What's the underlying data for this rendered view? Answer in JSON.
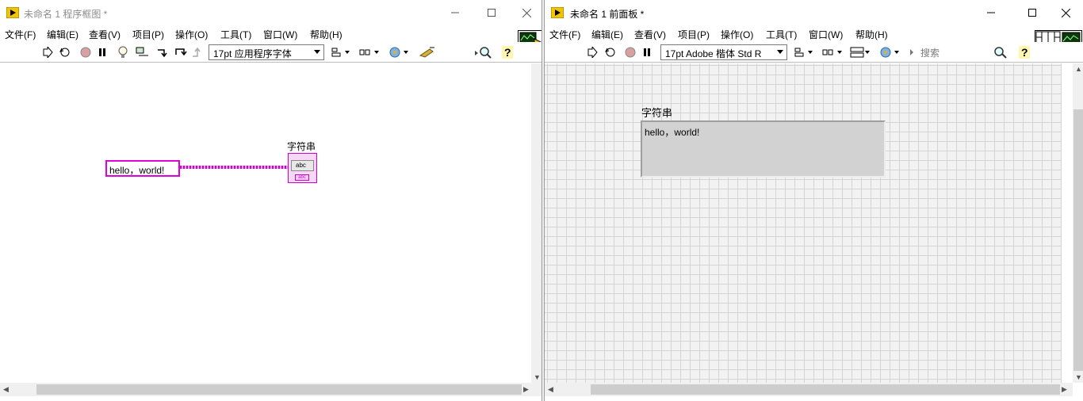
{
  "block_diagram": {
    "title": "未命名 1 程序框图 *",
    "menu": [
      "文件(F)",
      "编辑(E)",
      "查看(V)",
      "项目(P)",
      "操作(O)",
      "工具(T)",
      "窗口(W)",
      "帮助(H)"
    ],
    "font": "17pt 应用程序字体",
    "string_constant": "hello，world!",
    "indicator_label": "字符串",
    "terminal_text": "abc",
    "terminal_tag": "abc"
  },
  "front_panel": {
    "title": "未命名 1 前面板 *",
    "menu": [
      "文件(F)",
      "编辑(E)",
      "查看(V)",
      "项目(P)",
      "操作(O)",
      "工具(T)",
      "窗口(W)",
      "帮助(H)"
    ],
    "font": "17pt Adobe 楷体 Std R",
    "search_placeholder": "搜索",
    "indicator_label": "字符串",
    "indicator_value": "hello，world!"
  },
  "icons": {
    "run": "run-arrow-icon",
    "run_continuous": "run-continuously-icon",
    "abort": "abort-icon",
    "pause": "pause-icon",
    "highlight": "highlight-execution-icon",
    "retain_wire": "retain-wire-values-icon",
    "step_into": "step-into-icon",
    "step_over": "step-over-icon",
    "step_out": "step-out-icon",
    "align": "align-objects-icon",
    "distribute": "distribute-objects-icon",
    "reorder": "reorder-icon",
    "cleanup": "clean-up-diagram-icon",
    "search": "search-icon",
    "help": "context-help-icon",
    "minimize": "minimize-icon",
    "maximize": "maximize-icon",
    "close": "close-icon"
  },
  "colors": {
    "string_wire": "#d000d0",
    "labview_icon": "#f5c400",
    "grid": "#d4d4d4"
  }
}
